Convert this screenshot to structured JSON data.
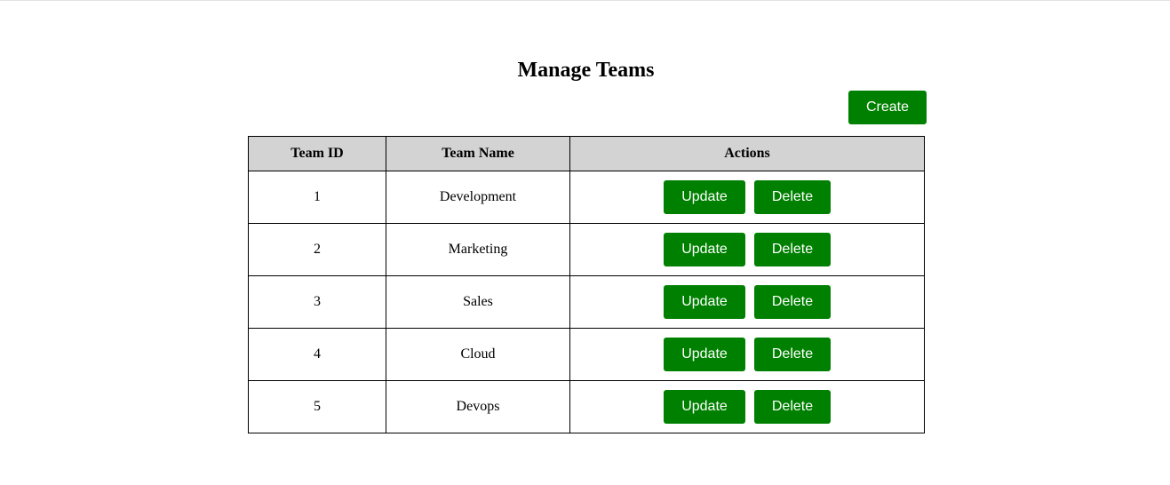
{
  "page": {
    "title": "Manage Teams",
    "create_label": "Create"
  },
  "table": {
    "headers": [
      "Team ID",
      "Team Name",
      "Actions"
    ],
    "rows": [
      {
        "id": "1",
        "name": "Development"
      },
      {
        "id": "2",
        "name": "Marketing"
      },
      {
        "id": "3",
        "name": "Sales"
      },
      {
        "id": "4",
        "name": "Cloud"
      },
      {
        "id": "5",
        "name": "Devops"
      }
    ],
    "update_label": "Update",
    "delete_label": "Delete"
  },
  "colors": {
    "button_bg": "#008000",
    "button_text": "#ffffff",
    "header_bg": "#d3d3d3"
  }
}
